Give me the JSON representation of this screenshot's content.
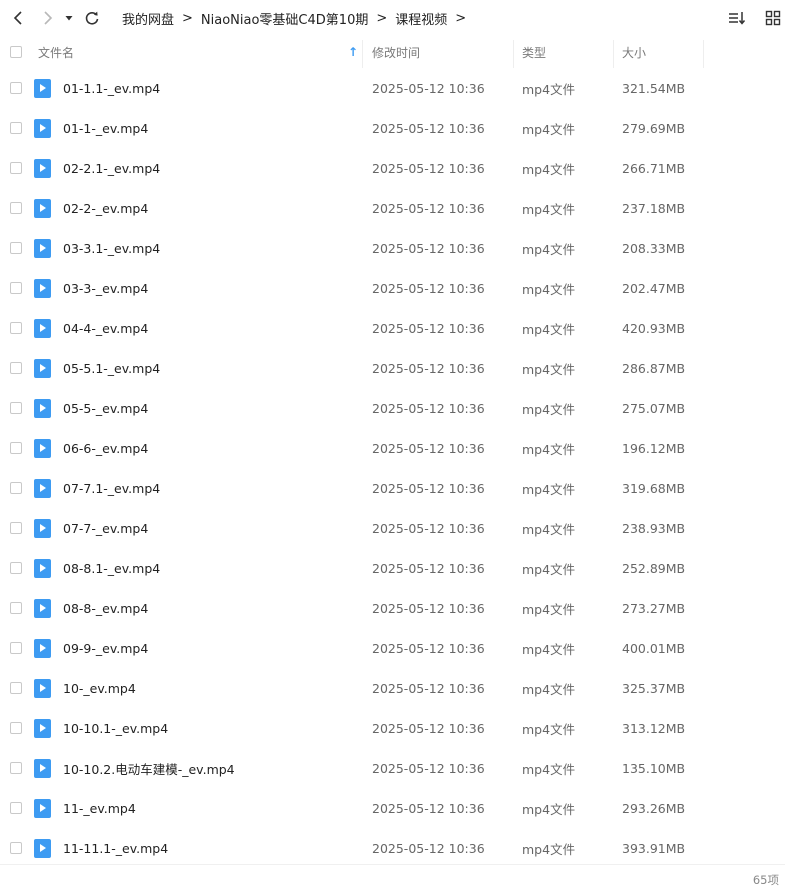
{
  "toolbar": {
    "back_icon": "chevron-left-icon",
    "forward_icon": "chevron-right-icon",
    "history_icon": "dropdown-triangle-icon",
    "refresh_icon": "refresh-icon",
    "sort_icon": "sort-list-icon",
    "view_icon": "grid-view-icon"
  },
  "breadcrumb": {
    "items": [
      "我的网盘",
      "NiaoNiao零基础C4D第10期",
      "课程视频"
    ],
    "separator": ">"
  },
  "columns": {
    "name": "文件名",
    "modified": "修改时间",
    "type": "类型",
    "size": "大小",
    "sort_indicator": "↑"
  },
  "files": [
    {
      "name": "01-1.1-_ev.mp4",
      "date": "2025-05-12 10:36",
      "type": "mp4文件",
      "size": "321.54MB"
    },
    {
      "name": "01-1-_ev.mp4",
      "date": "2025-05-12 10:36",
      "type": "mp4文件",
      "size": "279.69MB"
    },
    {
      "name": "02-2.1-_ev.mp4",
      "date": "2025-05-12 10:36",
      "type": "mp4文件",
      "size": "266.71MB"
    },
    {
      "name": "02-2-_ev.mp4",
      "date": "2025-05-12 10:36",
      "type": "mp4文件",
      "size": "237.18MB"
    },
    {
      "name": "03-3.1-_ev.mp4",
      "date": "2025-05-12 10:36",
      "type": "mp4文件",
      "size": "208.33MB"
    },
    {
      "name": "03-3-_ev.mp4",
      "date": "2025-05-12 10:36",
      "type": "mp4文件",
      "size": "202.47MB"
    },
    {
      "name": "04-4-_ev.mp4",
      "date": "2025-05-12 10:36",
      "type": "mp4文件",
      "size": "420.93MB"
    },
    {
      "name": "05-5.1-_ev.mp4",
      "date": "2025-05-12 10:36",
      "type": "mp4文件",
      "size": "286.87MB"
    },
    {
      "name": "05-5-_ev.mp4",
      "date": "2025-05-12 10:36",
      "type": "mp4文件",
      "size": "275.07MB"
    },
    {
      "name": "06-6-_ev.mp4",
      "date": "2025-05-12 10:36",
      "type": "mp4文件",
      "size": "196.12MB"
    },
    {
      "name": "07-7.1-_ev.mp4",
      "date": "2025-05-12 10:36",
      "type": "mp4文件",
      "size": "319.68MB"
    },
    {
      "name": "07-7-_ev.mp4",
      "date": "2025-05-12 10:36",
      "type": "mp4文件",
      "size": "238.93MB"
    },
    {
      "name": "08-8.1-_ev.mp4",
      "date": "2025-05-12 10:36",
      "type": "mp4文件",
      "size": "252.89MB"
    },
    {
      "name": "08-8-_ev.mp4",
      "date": "2025-05-12 10:36",
      "type": "mp4文件",
      "size": "273.27MB"
    },
    {
      "name": "09-9-_ev.mp4",
      "date": "2025-05-12 10:36",
      "type": "mp4文件",
      "size": "400.01MB"
    },
    {
      "name": "10-_ev.mp4",
      "date": "2025-05-12 10:36",
      "type": "mp4文件",
      "size": "325.37MB"
    },
    {
      "name": "10-10.1-_ev.mp4",
      "date": "2025-05-12 10:36",
      "type": "mp4文件",
      "size": "313.12MB"
    },
    {
      "name": "10-10.2.电动车建模-_ev.mp4",
      "date": "2025-05-12 10:36",
      "type": "mp4文件",
      "size": "135.10MB"
    },
    {
      "name": "11-_ev.mp4",
      "date": "2025-05-12 10:36",
      "type": "mp4文件",
      "size": "293.26MB"
    },
    {
      "name": "11-11.1-_ev.mp4",
      "date": "2025-05-12 10:36",
      "type": "mp4文件",
      "size": "393.91MB"
    }
  ],
  "file_icon": "video-file-icon",
  "footer": {
    "count": "65项"
  },
  "colors": {
    "file_icon": "#3d9bf2",
    "sort_arrow": "#3d9bf2"
  }
}
